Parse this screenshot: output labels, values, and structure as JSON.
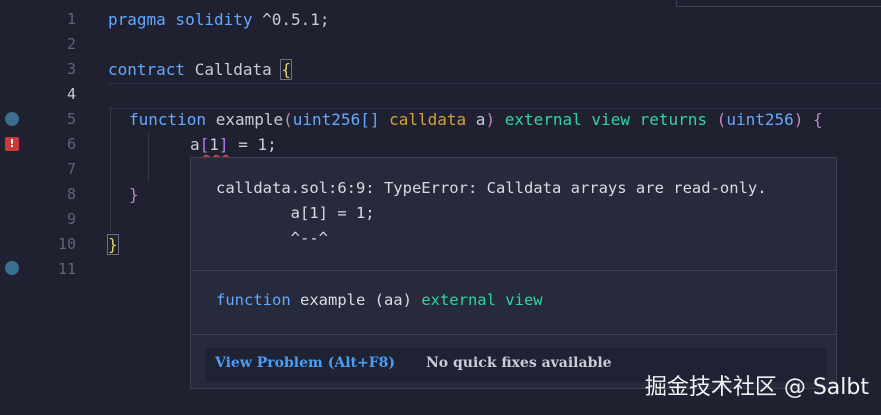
{
  "line_numbers": [
    "1",
    "2",
    "3",
    "4",
    "5",
    "6",
    "7",
    "8",
    "9",
    "10",
    "11"
  ],
  "code": {
    "l1": {
      "kw": "pragma solidity",
      "rest": " ^0.5.1;"
    },
    "l3": {
      "kw": "contract",
      "name": " Calldata ",
      "brace": "{"
    },
    "l5": {
      "kw": "function",
      "name": " example",
      "p1": "(",
      "t1": "uint256[]",
      "sp1": " ",
      "cd": "calldata",
      "var": " a",
      "p2": ")",
      "sp2": " ",
      "ext": "external",
      "sp3": " ",
      "view": "view",
      "sp4": " ",
      "ret": "returns",
      "sp5": " ",
      "p3": "(",
      "t2": "uint256",
      "p4": ")",
      "sp6": " ",
      "brace": "{"
    },
    "l6": {
      "a": "a",
      "b1": "[",
      "idx": "1",
      "b2": "]",
      "rest": " = 1;"
    },
    "l8": {
      "brace": "}"
    },
    "l10": {
      "brace": "}"
    }
  },
  "hover": {
    "error_line1": "calldata.sol:6:9: TypeError: Calldata arrays are read-only.",
    "error_line2": "        a[1] = 1;",
    "error_line3": "        ^--^",
    "sig_kw": "function",
    "sig_name": " example (aa) ",
    "sig_ext": "external",
    "sig_view": " view",
    "view_problem": "View Problem (Alt+F8)",
    "no_quick_fixes": "No quick fixes available"
  },
  "watermark": "掘金技术社区 @ Salbt",
  "colors": {
    "error": "#e0454a",
    "link": "#4e9df5",
    "keyword": "#64a8ff",
    "modifier": "#2fd4a6"
  }
}
